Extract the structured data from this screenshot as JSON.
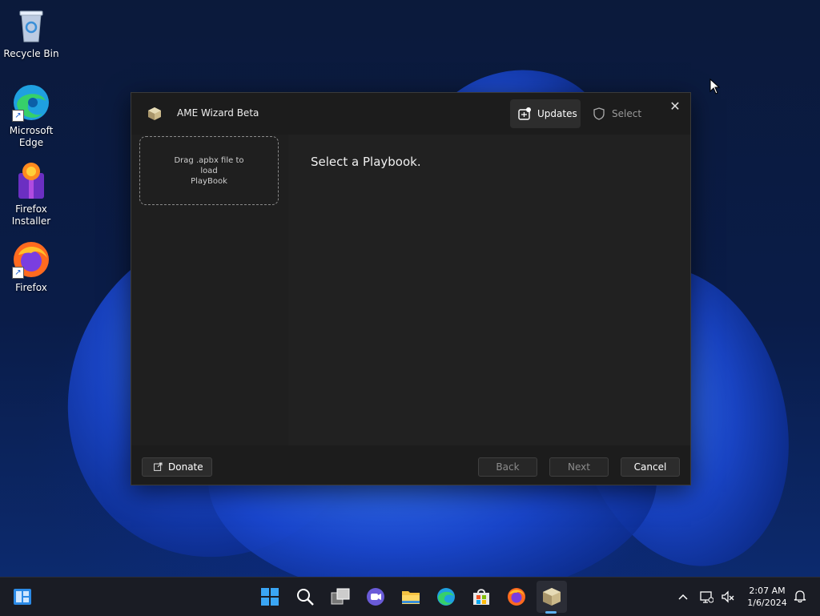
{
  "desktop": {
    "icons": [
      {
        "label": "Recycle Bin",
        "icon": "recycle-bin-icon"
      },
      {
        "label": "Microsoft\nEdge",
        "icon": "edge-icon"
      },
      {
        "label": "Firefox\nInstaller",
        "icon": "firefox-installer-icon"
      },
      {
        "label": "Firefox",
        "icon": "firefox-icon"
      }
    ]
  },
  "window": {
    "title": "AME Wizard Beta",
    "tabs": {
      "updates": "Updates",
      "select": "Select"
    },
    "dropzone_text": "Drag .apbx file to\nload\nPlayBook",
    "prompt": "Select a Playbook.",
    "buttons": {
      "donate": "Donate",
      "back": "Back",
      "next": "Next",
      "cancel": "Cancel"
    }
  },
  "taskbar": {
    "time": "2:07 AM",
    "date": "1/6/2024",
    "pinned": [
      "widgets-icon",
      "start-icon",
      "search-icon",
      "task-view-icon",
      "chat-icon",
      "file-explorer-icon",
      "edge-icon",
      "store-icon",
      "firefox-icon",
      "ame-wizard-icon"
    ]
  },
  "colors": {
    "window_bg": "#202020",
    "titlebar_bg": "#1c1c1c",
    "accent": "#5fb2f2"
  }
}
